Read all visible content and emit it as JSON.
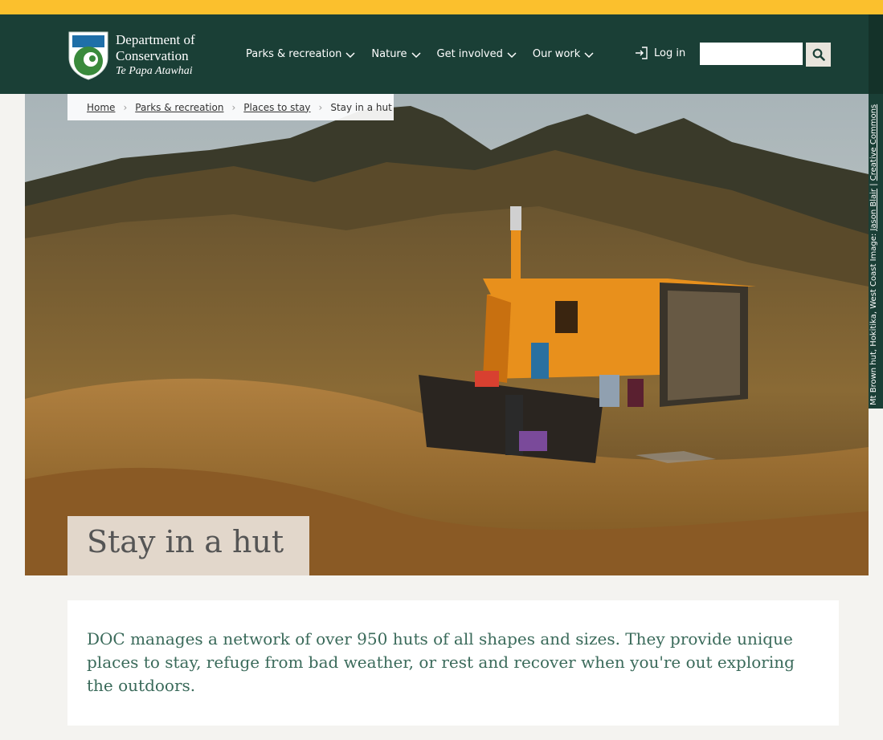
{
  "header": {
    "logo": {
      "line1": "Department of",
      "line2": "Conservation",
      "line3": "Te Papa Atawhai"
    },
    "nav": [
      {
        "label": "Parks & recreation"
      },
      {
        "label": "Nature"
      },
      {
        "label": "Get involved"
      },
      {
        "label": "Our work"
      }
    ],
    "login_label": "Log in",
    "search": {
      "placeholder": "",
      "value": ""
    }
  },
  "breadcrumb": {
    "items": [
      "Home",
      "Parks & recreation",
      "Places to stay"
    ],
    "current": "Stay in a hut"
  },
  "hero": {
    "title": "Stay in a hut",
    "credit": {
      "caption": "Mt Brown hut, Hokitika, West Coast",
      "image_prefix": "Image:",
      "author": "Jason Blair",
      "license": "Creative Commons"
    }
  },
  "intro": {
    "text": "DOC manages a network of over 950 huts of all shapes and sizes. They provide unique places to stay, refuge from bad weather, or rest and recover when you're out exploring the outdoors."
  },
  "colors": {
    "accent_yellow": "#fbc02d",
    "header_green": "#1a3f36",
    "intro_text": "#3a6a5a",
    "hut_orange": "#e8901c"
  }
}
